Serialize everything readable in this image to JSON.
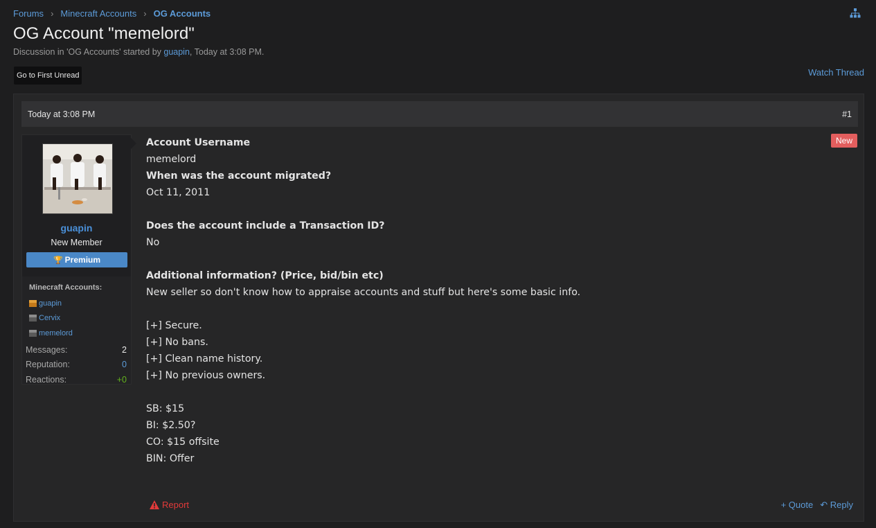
{
  "breadcrumb": [
    "Forums",
    "Minecraft Accounts",
    "OG Accounts"
  ],
  "title": "OG Account \"memelord\"",
  "description": {
    "prefix": "Discussion in 'OG Accounts' started by ",
    "author": "guapin",
    "suffix": ", Today at 3:08 PM."
  },
  "first_unread_label": "Go to First Unread",
  "watch_thread_label": "Watch Thread",
  "post": {
    "date": "Today at 3:08 PM",
    "number": "#1",
    "new_badge": "New",
    "user": {
      "name": "guapin",
      "title": "New Member",
      "banner": "Premium",
      "accounts_heading": "Minecraft Accounts:",
      "accounts": [
        "guapin",
        "Cervix",
        "memelord"
      ],
      "stats": [
        {
          "label": "Messages:",
          "value": "2"
        },
        {
          "label": "Reputation:",
          "value": "0"
        },
        {
          "label": "Reactions:",
          "value": "+0"
        }
      ]
    },
    "body": {
      "q1": "Account Username",
      "a1": "memelord",
      "q2": "When was the account migrated?",
      "a2": "Oct 11, 2011",
      "q3": "Does the account include a Transaction ID?",
      "a3": "No",
      "q4": "Additional information? (Price, bid/bin etc)",
      "a4": "New seller so don't know how to appraise accounts and stuff but here's some basic info.",
      "features": [
        "[+] Secure.",
        "[+] No bans.",
        "[+] Clean name history.",
        "[+] No previous owners."
      ],
      "prices": [
        "SB: $15",
        "BI: $2.50?",
        "CO: $15 offsite",
        "BIN: Offer"
      ]
    },
    "report_label": "Report",
    "quote_label": "+ Quote",
    "reply_label": "Reply"
  }
}
